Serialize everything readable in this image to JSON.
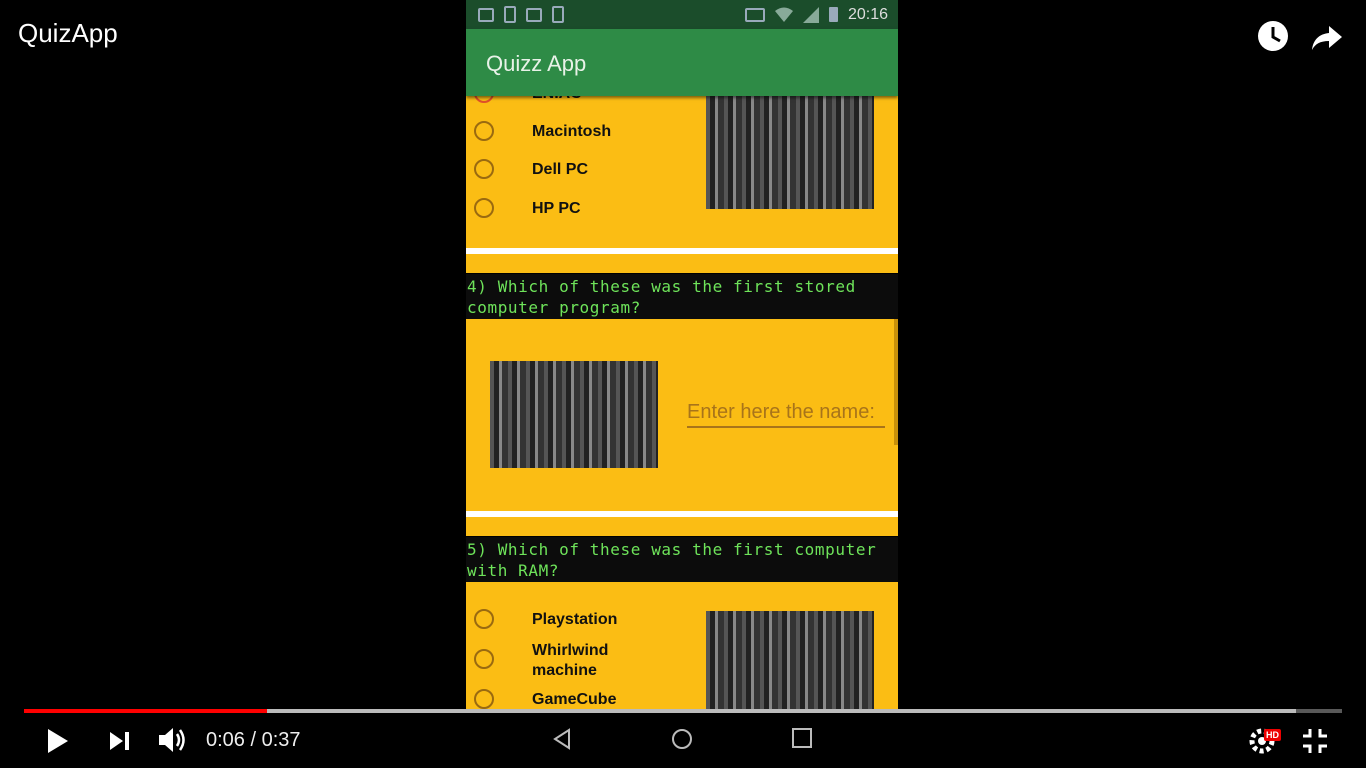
{
  "video": {
    "title": "QuizApp"
  },
  "status_bar": {
    "time": "20:16"
  },
  "app": {
    "title": "Quizz App"
  },
  "question3": {
    "options": [
      {
        "label": "ENIAC",
        "checked": true
      },
      {
        "label": "Macintosh",
        "checked": false
      },
      {
        "label": "Dell PC",
        "checked": false
      },
      {
        "label": "HP PC",
        "checked": false
      }
    ]
  },
  "question4": {
    "text": "4) Which of these was the first stored computer program?",
    "input_placeholder": "Enter here the name:"
  },
  "question5": {
    "text": "5) Which of these was the first computer with RAM?",
    "options": [
      {
        "label": "Playstation",
        "checked": false
      },
      {
        "label": "Whirlwind machine",
        "checked": false
      },
      {
        "label": "GameCube",
        "checked": false
      }
    ]
  },
  "player": {
    "time_display": "0:06 / 0:37",
    "played_fraction": 0.184,
    "loaded_fraction": 0.965,
    "hd_badge": "HD"
  },
  "colors": {
    "accent": "#ff0000",
    "card": "#fbbd14",
    "app_bar": "#2e8b46",
    "question_text": "#6ee35a"
  }
}
